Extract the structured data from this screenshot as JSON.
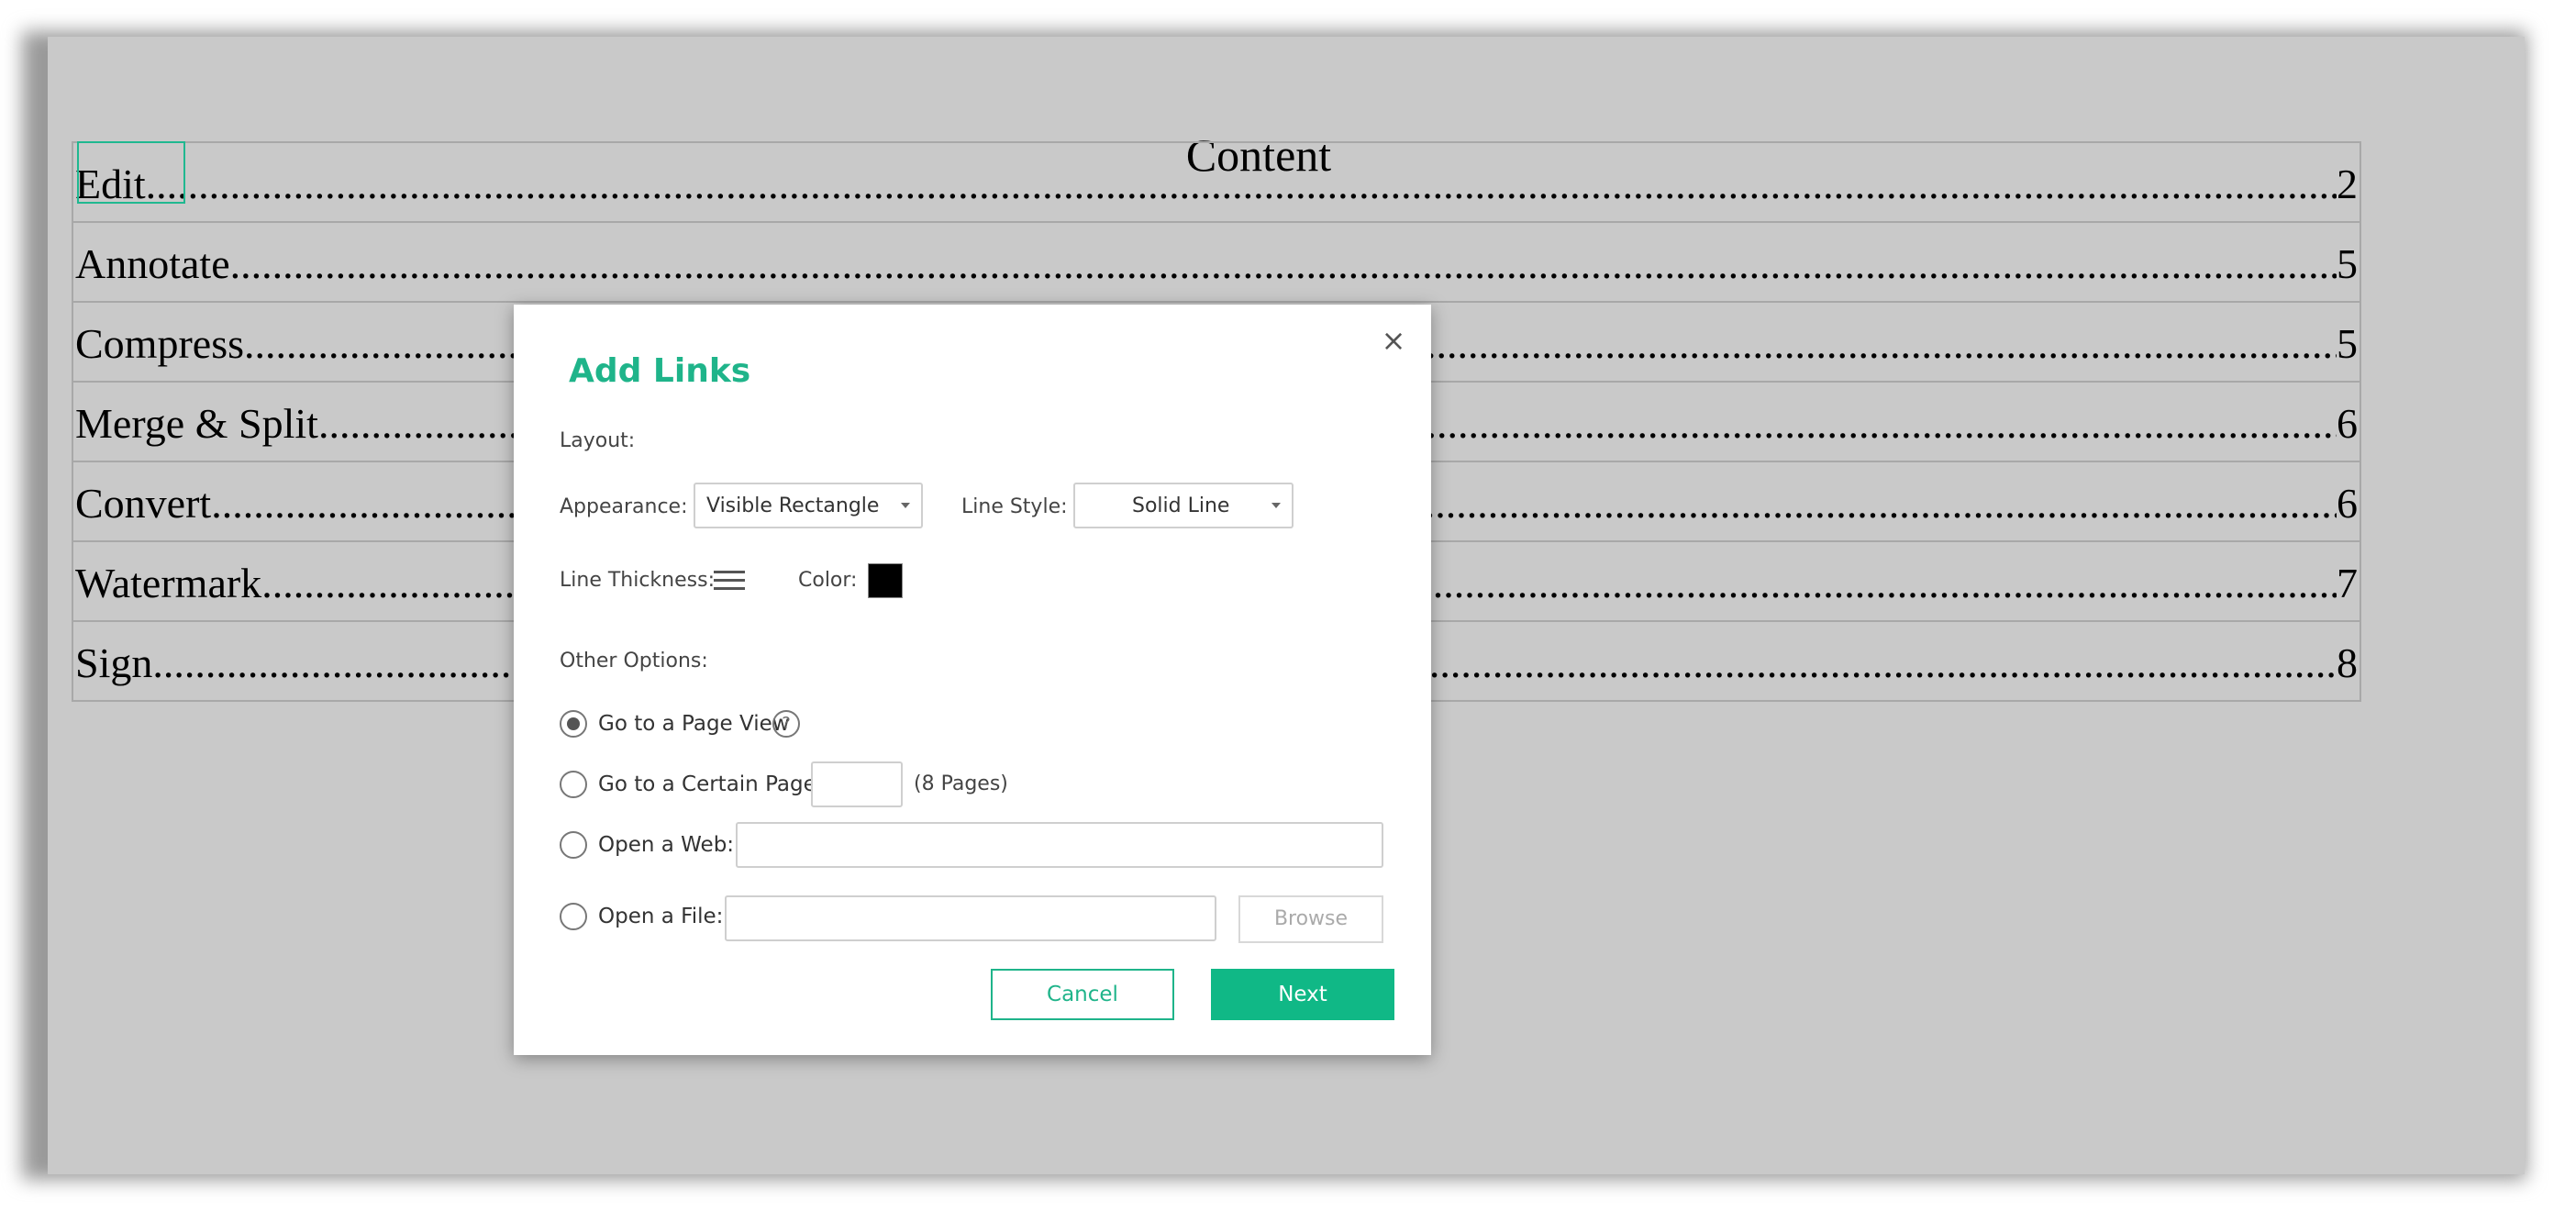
{
  "document": {
    "title": "Content",
    "toc": [
      {
        "label": "Edit",
        "page": "2"
      },
      {
        "label": "Annotate",
        "page": "5"
      },
      {
        "label": "Compress",
        "page": "5"
      },
      {
        "label": "Merge & Split",
        "page": "6"
      },
      {
        "label": "Convert",
        "page": "6"
      },
      {
        "label": "Watermark",
        "page": "7"
      },
      {
        "label": "Sign",
        "page": "8"
      }
    ]
  },
  "dialog": {
    "title": "Add Links",
    "close_icon": "×",
    "layout_label": "Layout:",
    "appearance_label": "Appearance:",
    "appearance_value": "Visible Rectangle",
    "line_style_label": "Line Style:",
    "line_style_value": "Solid Line",
    "line_thickness_label": "Line Thickness:",
    "color_label": "Color:",
    "color_value": "#000000",
    "other_options_label": "Other Options:",
    "options": {
      "page_view": "Go to a Page View",
      "certain_page": "Go to a Certain Page:",
      "certain_page_value": "",
      "pages_note": "(8 Pages)",
      "open_web": "Open a Web:",
      "open_web_value": "",
      "open_file": "Open a File:",
      "open_file_value": "",
      "selected": "page_view"
    },
    "help_icon": "?",
    "browse_label": "Browse",
    "cancel_label": "Cancel",
    "next_label": "Next"
  },
  "colors": {
    "accent": "#1fb48a",
    "next_button": "#10b886",
    "page_background": "#c9c9c9"
  }
}
